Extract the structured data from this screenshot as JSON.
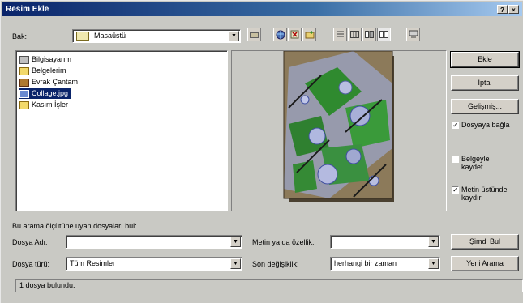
{
  "window": {
    "title": "Resim Ekle",
    "help_label": "?",
    "close_label": "×"
  },
  "lookin": {
    "label": "Bak:",
    "value": "Masaüstü"
  },
  "files": [
    {
      "name": "Bilgisayarım",
      "icon": "computer-icon",
      "selected": false
    },
    {
      "name": "Belgelerim",
      "icon": "folder-icon",
      "selected": false
    },
    {
      "name": "Evrak Çantam",
      "icon": "briefcase-icon",
      "selected": false
    },
    {
      "name": "Collage.jpg",
      "icon": "image-file-icon",
      "selected": true
    },
    {
      "name": "Kasım İşler",
      "icon": "folder-icon",
      "selected": false
    }
  ],
  "buttons": {
    "insert": "Ekle",
    "cancel": "İptal",
    "advanced": "Gelişmiş...",
    "find_now": "Şimdi Bul",
    "new_search": "Yeni Arama"
  },
  "options": {
    "link": {
      "label": "Dosyaya bağla",
      "checked": true
    },
    "save_with_doc": {
      "label": "Belgeyle kaydet",
      "checked": false
    },
    "above_text": {
      "label": "Metin üstünde kaydır",
      "checked": true
    }
  },
  "search": {
    "header": "Bu arama ölçütüne uyan dosyaları bul:",
    "filename_label": "Dosya Adı:",
    "filename_value": "",
    "filetype_label": "Dosya türü:",
    "filetype_value": "Tüm Resimler",
    "text_label": "Metin ya da özellik:",
    "text_value": "",
    "modified_label": "Son değişiklik:",
    "modified_value": "herhangi bir zaman"
  },
  "status": "1 dosya bulundu."
}
